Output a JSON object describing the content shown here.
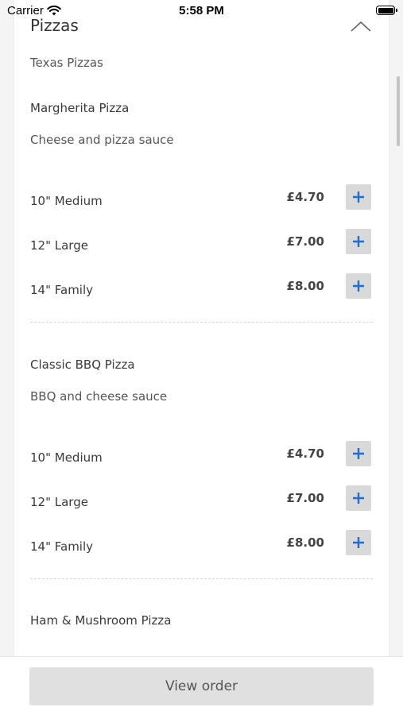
{
  "status_bar": {
    "carrier": "Carrier",
    "time": "5:58 PM"
  },
  "section": {
    "title": "Pizzas",
    "subtitle": "Texas Pizzas"
  },
  "items": [
    {
      "name": "Margherita Pizza",
      "description": "Cheese and pizza sauce",
      "sizes": [
        {
          "label": "10\" Medium",
          "price": "£4.70"
        },
        {
          "label": "12\" Large",
          "price": "£7.00"
        },
        {
          "label": "14\" Family",
          "price": "£8.00"
        }
      ]
    },
    {
      "name": "Classic BBQ Pizza",
      "description": "BBQ and cheese sauce",
      "sizes": [
        {
          "label": "10\" Medium",
          "price": "£4.70"
        },
        {
          "label": "12\" Large",
          "price": "£7.00"
        },
        {
          "label": "14\" Family",
          "price": "£8.00"
        }
      ]
    },
    {
      "name": "Ham & Mushroom Pizza"
    }
  ],
  "add_icon": "plus-icon",
  "accent_color": "#1f6fd1",
  "footer": {
    "view_order_label": "View order"
  }
}
